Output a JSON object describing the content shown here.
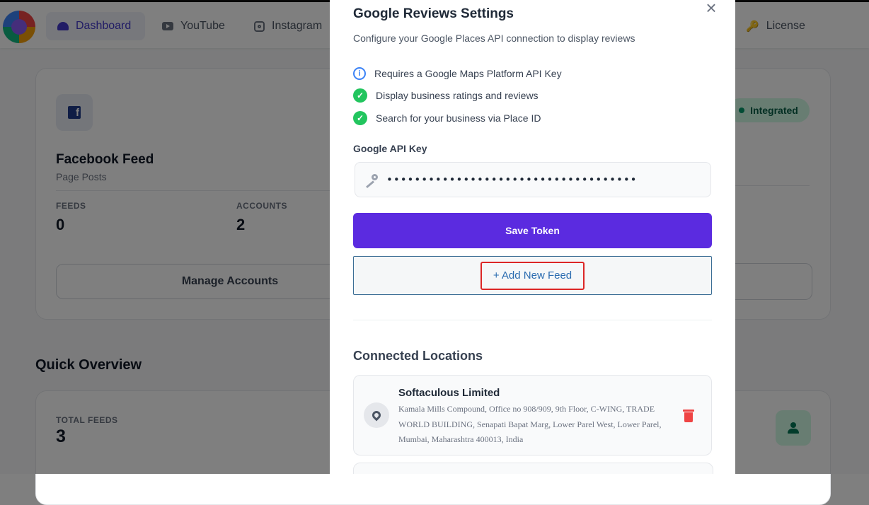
{
  "nav": {
    "items": [
      {
        "label": "Dashboard",
        "icon": "dashboard-gauge-icon",
        "active": true
      },
      {
        "label": "YouTube",
        "icon": "youtube-icon"
      },
      {
        "label": "Instagram",
        "icon": "instagram-icon"
      },
      {
        "label": "License",
        "icon": "key-icon"
      }
    ]
  },
  "facebook_card": {
    "title": "Facebook Feed",
    "subtitle": "Page Posts",
    "stats": [
      {
        "label": "FEEDS",
        "value": "0"
      },
      {
        "label": "ACCOUNTS",
        "value": "2"
      }
    ],
    "manage_label": "Manage Accounts"
  },
  "integrated_badge": "Integrated",
  "overview": {
    "title": "Quick Overview",
    "total_label": "TOTAL FEEDS",
    "total_value": "3"
  },
  "modal": {
    "title": "Google Reviews Settings",
    "description": "Configure your Google Places API connection to display reviews",
    "features": [
      {
        "text": "Requires a Google Maps Platform API Key",
        "icon": "info-icon"
      },
      {
        "text": "Display business ratings and reviews",
        "icon": "check-circle-icon"
      },
      {
        "text": "Search for your business via Place ID",
        "icon": "check-circle-icon"
      }
    ],
    "api_key_label": "Google API Key",
    "api_key_value": "••••••••••••••••••••••••••••••••••••",
    "save_label": "Save Token",
    "add_feed_label": "+ Add New Feed",
    "connected_title": "Connected Locations",
    "locations": [
      {
        "name": "Softaculous Limited",
        "address": "Kamala Mills Compound, Office no 908/909, 9th Floor, C-WING, TRADE WORLD BUILDING, Senapati Bapat Marg, Lower Parel West, Lower Parel, Mumbai, Maharashtra 400013, India"
      }
    ]
  },
  "colors": {
    "primary": "#5b2be0",
    "nav_active": "#4338ca",
    "success": "#22c55e",
    "danger": "#ef4444",
    "highlight_border": "#dc2626"
  }
}
